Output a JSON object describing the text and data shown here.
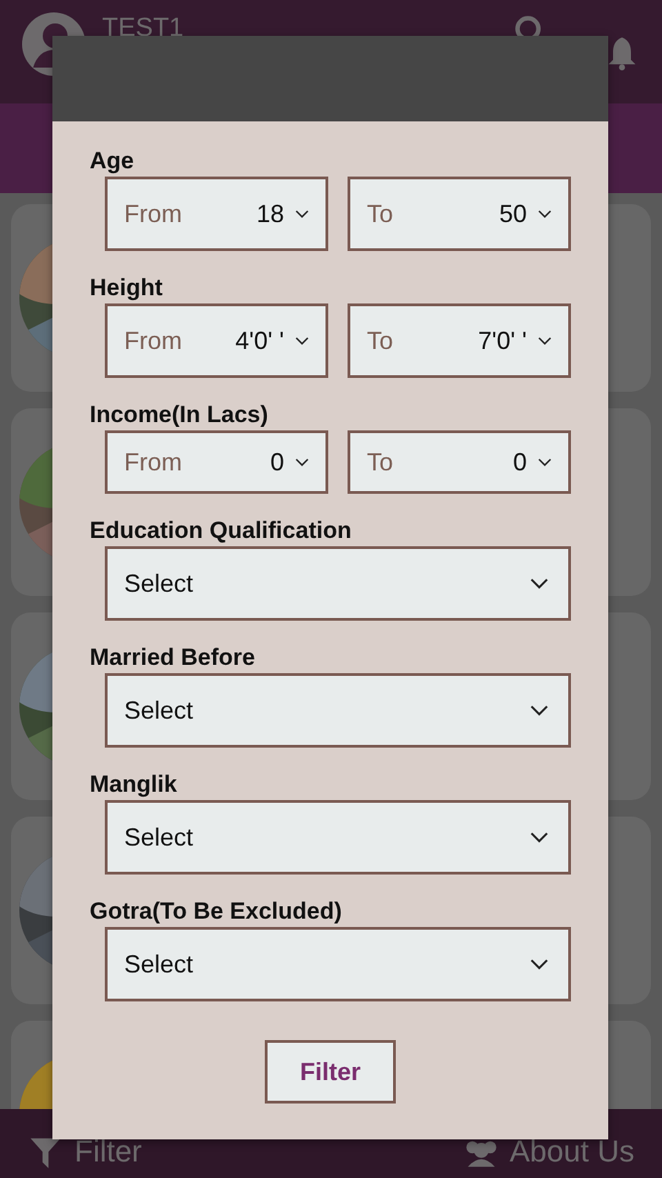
{
  "header": {
    "user_name": "TEST1"
  },
  "filter_dialog": {
    "sections": [
      {
        "label": "Age",
        "kind": "range",
        "from": {
          "label": "From",
          "value": "18"
        },
        "to": {
          "label": "To",
          "value": "50"
        }
      },
      {
        "label": "Height",
        "kind": "range",
        "from": {
          "label": "From",
          "value": "4'0' '"
        },
        "to": {
          "label": "To",
          "value": "7'0' '"
        }
      },
      {
        "label": "Income(In Lacs)",
        "kind": "compact_range",
        "from": {
          "label": "From",
          "value": "0"
        },
        "to": {
          "label": "To",
          "value": "0"
        }
      },
      {
        "label": "Education Qualification",
        "kind": "select",
        "value": "Select"
      },
      {
        "label": "Married Before",
        "kind": "select",
        "value": "Select"
      },
      {
        "label": "Manglik",
        "kind": "select",
        "value": "Select"
      },
      {
        "label": "Gotra(To Be Excluded)",
        "kind": "select",
        "value": "Select"
      }
    ],
    "button": "Filter"
  },
  "bottom_bar": [
    {
      "kind": "filter",
      "label": "Filter"
    },
    {
      "kind": "about",
      "label": "About Us"
    }
  ]
}
